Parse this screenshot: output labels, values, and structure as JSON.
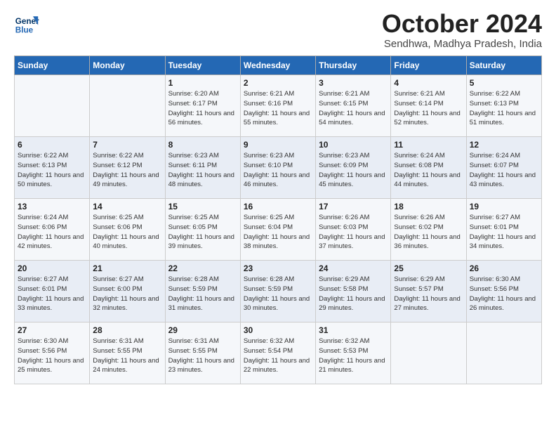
{
  "header": {
    "logo_line1": "General",
    "logo_line2": "Blue",
    "month": "October 2024",
    "location": "Sendhwa, Madhya Pradesh, India"
  },
  "weekdays": [
    "Sunday",
    "Monday",
    "Tuesday",
    "Wednesday",
    "Thursday",
    "Friday",
    "Saturday"
  ],
  "weeks": [
    [
      {
        "day": "",
        "sunrise": "",
        "sunset": "",
        "daylight": ""
      },
      {
        "day": "",
        "sunrise": "",
        "sunset": "",
        "daylight": ""
      },
      {
        "day": "1",
        "sunrise": "Sunrise: 6:20 AM",
        "sunset": "Sunset: 6:17 PM",
        "daylight": "Daylight: 11 hours and 56 minutes."
      },
      {
        "day": "2",
        "sunrise": "Sunrise: 6:21 AM",
        "sunset": "Sunset: 6:16 PM",
        "daylight": "Daylight: 11 hours and 55 minutes."
      },
      {
        "day": "3",
        "sunrise": "Sunrise: 6:21 AM",
        "sunset": "Sunset: 6:15 PM",
        "daylight": "Daylight: 11 hours and 54 minutes."
      },
      {
        "day": "4",
        "sunrise": "Sunrise: 6:21 AM",
        "sunset": "Sunset: 6:14 PM",
        "daylight": "Daylight: 11 hours and 52 minutes."
      },
      {
        "day": "5",
        "sunrise": "Sunrise: 6:22 AM",
        "sunset": "Sunset: 6:13 PM",
        "daylight": "Daylight: 11 hours and 51 minutes."
      }
    ],
    [
      {
        "day": "6",
        "sunrise": "Sunrise: 6:22 AM",
        "sunset": "Sunset: 6:13 PM",
        "daylight": "Daylight: 11 hours and 50 minutes."
      },
      {
        "day": "7",
        "sunrise": "Sunrise: 6:22 AM",
        "sunset": "Sunset: 6:12 PM",
        "daylight": "Daylight: 11 hours and 49 minutes."
      },
      {
        "day": "8",
        "sunrise": "Sunrise: 6:23 AM",
        "sunset": "Sunset: 6:11 PM",
        "daylight": "Daylight: 11 hours and 48 minutes."
      },
      {
        "day": "9",
        "sunrise": "Sunrise: 6:23 AM",
        "sunset": "Sunset: 6:10 PM",
        "daylight": "Daylight: 11 hours and 46 minutes."
      },
      {
        "day": "10",
        "sunrise": "Sunrise: 6:23 AM",
        "sunset": "Sunset: 6:09 PM",
        "daylight": "Daylight: 11 hours and 45 minutes."
      },
      {
        "day": "11",
        "sunrise": "Sunrise: 6:24 AM",
        "sunset": "Sunset: 6:08 PM",
        "daylight": "Daylight: 11 hours and 44 minutes."
      },
      {
        "day": "12",
        "sunrise": "Sunrise: 6:24 AM",
        "sunset": "Sunset: 6:07 PM",
        "daylight": "Daylight: 11 hours and 43 minutes."
      }
    ],
    [
      {
        "day": "13",
        "sunrise": "Sunrise: 6:24 AM",
        "sunset": "Sunset: 6:06 PM",
        "daylight": "Daylight: 11 hours and 42 minutes."
      },
      {
        "day": "14",
        "sunrise": "Sunrise: 6:25 AM",
        "sunset": "Sunset: 6:06 PM",
        "daylight": "Daylight: 11 hours and 40 minutes."
      },
      {
        "day": "15",
        "sunrise": "Sunrise: 6:25 AM",
        "sunset": "Sunset: 6:05 PM",
        "daylight": "Daylight: 11 hours and 39 minutes."
      },
      {
        "day": "16",
        "sunrise": "Sunrise: 6:25 AM",
        "sunset": "Sunset: 6:04 PM",
        "daylight": "Daylight: 11 hours and 38 minutes."
      },
      {
        "day": "17",
        "sunrise": "Sunrise: 6:26 AM",
        "sunset": "Sunset: 6:03 PM",
        "daylight": "Daylight: 11 hours and 37 minutes."
      },
      {
        "day": "18",
        "sunrise": "Sunrise: 6:26 AM",
        "sunset": "Sunset: 6:02 PM",
        "daylight": "Daylight: 11 hours and 36 minutes."
      },
      {
        "day": "19",
        "sunrise": "Sunrise: 6:27 AM",
        "sunset": "Sunset: 6:01 PM",
        "daylight": "Daylight: 11 hours and 34 minutes."
      }
    ],
    [
      {
        "day": "20",
        "sunrise": "Sunrise: 6:27 AM",
        "sunset": "Sunset: 6:01 PM",
        "daylight": "Daylight: 11 hours and 33 minutes."
      },
      {
        "day": "21",
        "sunrise": "Sunrise: 6:27 AM",
        "sunset": "Sunset: 6:00 PM",
        "daylight": "Daylight: 11 hours and 32 minutes."
      },
      {
        "day": "22",
        "sunrise": "Sunrise: 6:28 AM",
        "sunset": "Sunset: 5:59 PM",
        "daylight": "Daylight: 11 hours and 31 minutes."
      },
      {
        "day": "23",
        "sunrise": "Sunrise: 6:28 AM",
        "sunset": "Sunset: 5:59 PM",
        "daylight": "Daylight: 11 hours and 30 minutes."
      },
      {
        "day": "24",
        "sunrise": "Sunrise: 6:29 AM",
        "sunset": "Sunset: 5:58 PM",
        "daylight": "Daylight: 11 hours and 29 minutes."
      },
      {
        "day": "25",
        "sunrise": "Sunrise: 6:29 AM",
        "sunset": "Sunset: 5:57 PM",
        "daylight": "Daylight: 11 hours and 27 minutes."
      },
      {
        "day": "26",
        "sunrise": "Sunrise: 6:30 AM",
        "sunset": "Sunset: 5:56 PM",
        "daylight": "Daylight: 11 hours and 26 minutes."
      }
    ],
    [
      {
        "day": "27",
        "sunrise": "Sunrise: 6:30 AM",
        "sunset": "Sunset: 5:56 PM",
        "daylight": "Daylight: 11 hours and 25 minutes."
      },
      {
        "day": "28",
        "sunrise": "Sunrise: 6:31 AM",
        "sunset": "Sunset: 5:55 PM",
        "daylight": "Daylight: 11 hours and 24 minutes."
      },
      {
        "day": "29",
        "sunrise": "Sunrise: 6:31 AM",
        "sunset": "Sunset: 5:55 PM",
        "daylight": "Daylight: 11 hours and 23 minutes."
      },
      {
        "day": "30",
        "sunrise": "Sunrise: 6:32 AM",
        "sunset": "Sunset: 5:54 PM",
        "daylight": "Daylight: 11 hours and 22 minutes."
      },
      {
        "day": "31",
        "sunrise": "Sunrise: 6:32 AM",
        "sunset": "Sunset: 5:53 PM",
        "daylight": "Daylight: 11 hours and 21 minutes."
      },
      {
        "day": "",
        "sunrise": "",
        "sunset": "",
        "daylight": ""
      },
      {
        "day": "",
        "sunrise": "",
        "sunset": "",
        "daylight": ""
      }
    ]
  ]
}
